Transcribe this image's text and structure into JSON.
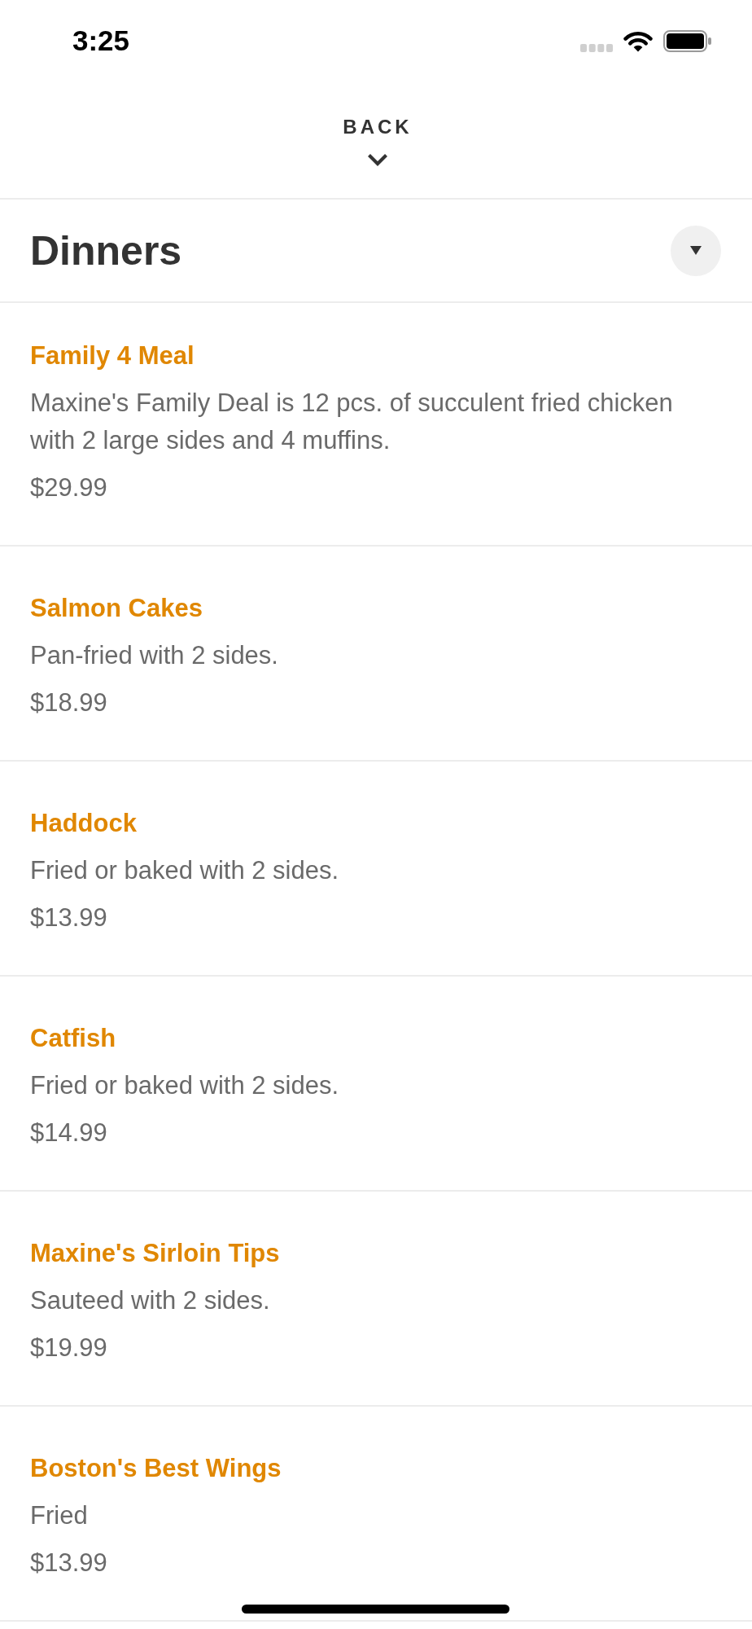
{
  "status_bar": {
    "time": "3:25"
  },
  "nav": {
    "back_label": "BACK"
  },
  "section": {
    "title": "Dinners"
  },
  "items": [
    {
      "name": "Family 4 Meal",
      "description": "Maxine's Family Deal is 12 pcs. of succulent fried chicken with 2 large sides and 4 muffins.",
      "price": "$29.99"
    },
    {
      "name": "Salmon Cakes",
      "description": "Pan-fried with 2 sides.",
      "price": "$18.99"
    },
    {
      "name": "Haddock",
      "description": "Fried or baked with 2 sides.",
      "price": "$13.99"
    },
    {
      "name": "Catfish",
      "description": "Fried or baked with 2 sides.",
      "price": "$14.99"
    },
    {
      "name": "Maxine's Sirloin Tips",
      "description": "Sauteed with 2 sides.",
      "price": "$19.99"
    },
    {
      "name": "Boston's Best Wings",
      "description": "Fried",
      "price": "$13.99"
    }
  ]
}
